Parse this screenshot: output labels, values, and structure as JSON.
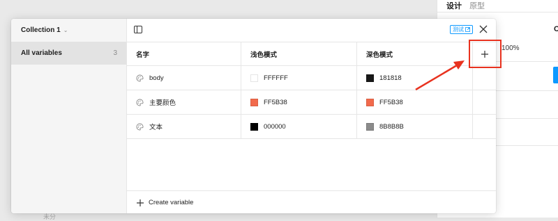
{
  "background_panel": {
    "tabs": [
      "设计",
      "原型"
    ],
    "percent": "100%",
    "partial_char": "C",
    "bottom_text": "未分"
  },
  "modal": {
    "collection_title": "Collection 1",
    "sidebar": {
      "items": [
        {
          "label": "All variables",
          "count": "3"
        }
      ]
    },
    "toolbar": {
      "test_label": "测试"
    },
    "table": {
      "headers": [
        "名字",
        "浅色模式",
        "深色模式"
      ],
      "rows": [
        {
          "name": "body",
          "light": {
            "hex": "FFFFFF",
            "color": "#FFFFFF"
          },
          "dark": {
            "hex": "181818",
            "color": "#181818"
          }
        },
        {
          "name": "主要颜色",
          "light": {
            "hex": "FF5B38",
            "color": "#F26A4C"
          },
          "dark": {
            "hex": "FF5B38",
            "color": "#F26A4C"
          }
        },
        {
          "name": "文本",
          "light": {
            "hex": "000000",
            "color": "#000000"
          },
          "dark": {
            "hex": "8B8B8B",
            "color": "#8B8B8B"
          }
        }
      ]
    },
    "footer": {
      "create_label": "Create variable"
    }
  },
  "annotation_color": "#E8321F"
}
